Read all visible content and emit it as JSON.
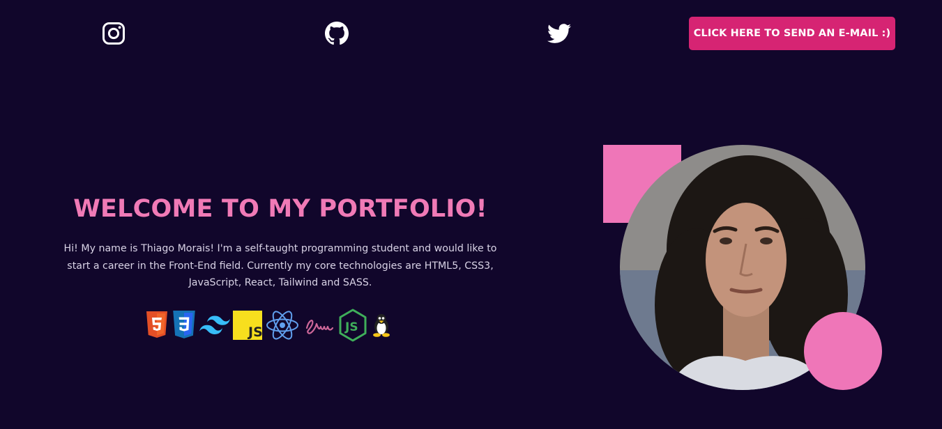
{
  "header": {
    "social": [
      {
        "name": "instagram",
        "icon": "instagram-icon"
      },
      {
        "name": "github",
        "icon": "github-icon"
      },
      {
        "name": "twitter",
        "icon": "twitter-icon"
      }
    ],
    "email_button_label": "CLICK HERE TO SEND AN E-MAIL :)"
  },
  "hero": {
    "title": "WELCOME TO MY PORTFOLIO!",
    "description": "Hi! My name is Thiago Morais! I'm a self-taught programming student and would like to start a career in the Front-End field. Currently my core technologies are HTML5, CSS3, JavaScript, React, Tailwind and SASS.",
    "technologies": [
      {
        "icon": "html5-icon",
        "color": "#f06529"
      },
      {
        "icon": "css3-icon",
        "color": "#2965f1"
      },
      {
        "icon": "tailwind-icon",
        "color": "#38bdf8"
      },
      {
        "icon": "javascript-icon",
        "color": "#f7df1e"
      },
      {
        "icon": "react-icon",
        "color": "#61dafb"
      },
      {
        "icon": "sass-icon",
        "color": "#cd6799"
      },
      {
        "icon": "nodejs-icon",
        "color": "#3fae5a"
      },
      {
        "icon": "linux-tux-icon",
        "color": "#f5c518"
      }
    ]
  },
  "profile": {
    "photo": "profile-photo",
    "accent_color": "#ef76b8"
  },
  "colors": {
    "background": "#11062b",
    "title": "#f07ab6",
    "button": "#d62473",
    "body_text": "#d9d3e6"
  }
}
